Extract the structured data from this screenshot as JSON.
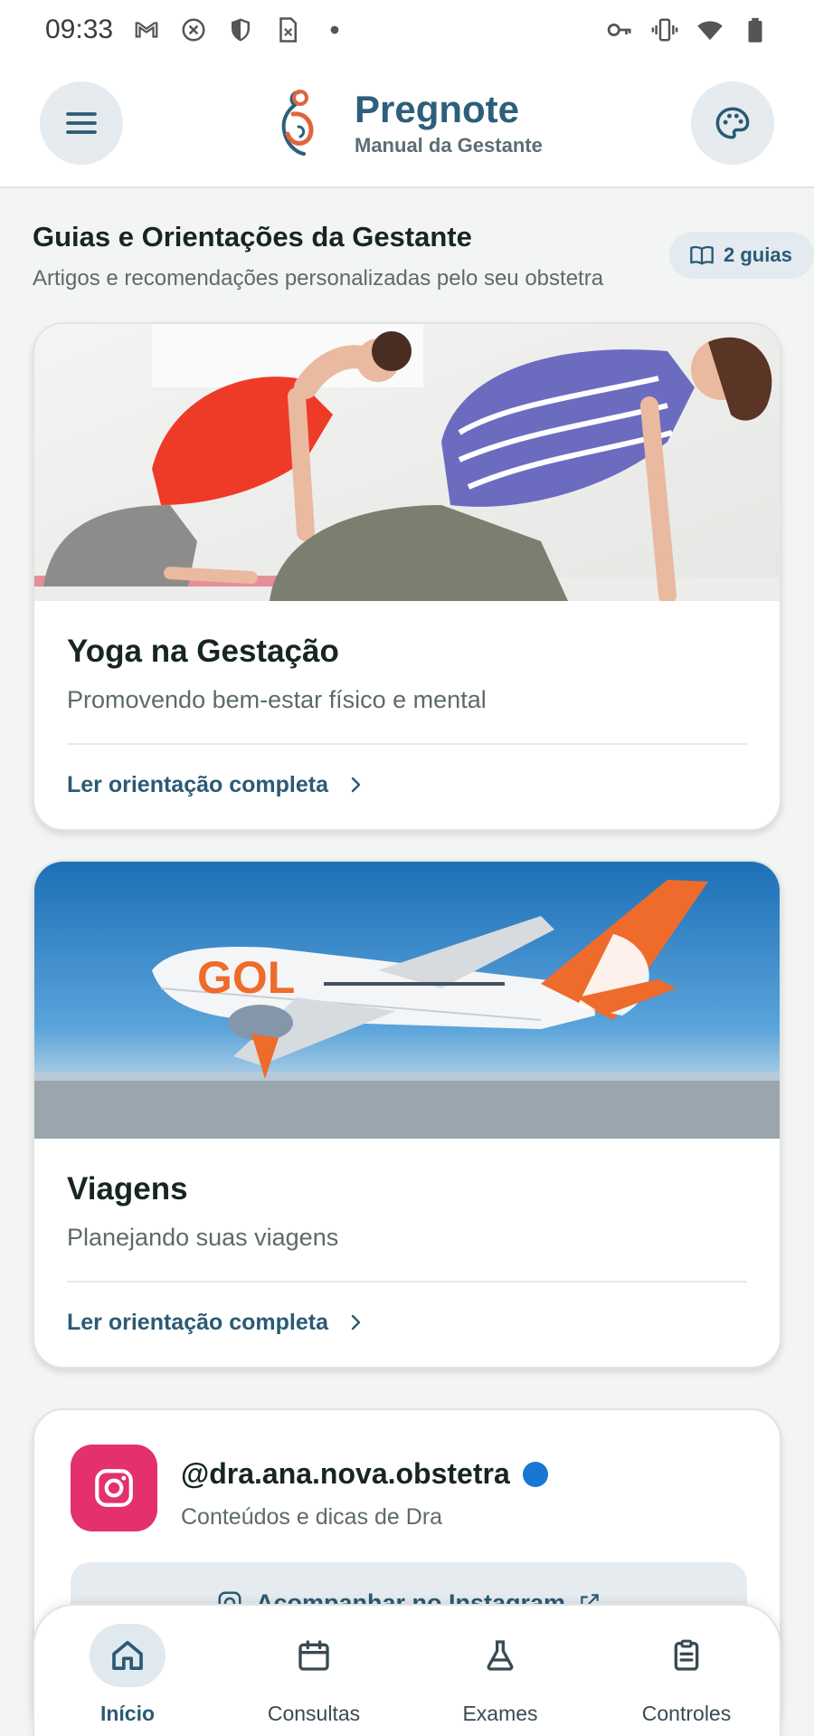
{
  "status_bar": {
    "time": "09:33",
    "left_icons": [
      "gmail-icon",
      "close-circle-icon",
      "shield-icon",
      "file-x-icon",
      "dot-icon"
    ],
    "right_icons": [
      "key-icon",
      "vibrate-icon",
      "wifi-icon",
      "battery-icon"
    ]
  },
  "app_bar": {
    "title": "Pregnote",
    "subtitle": "Manual da Gestante",
    "menu_icon": "hamburger-menu-icon",
    "palette_icon": "palette-icon"
  },
  "section": {
    "title": "Guias e Orientações da Gestante",
    "subtitle": "Artigos e recomendações personalizadas pelo seu obstetra",
    "badge": "2 guias"
  },
  "guides": [
    {
      "title": "Yoga na Gestação",
      "subtitle": "Promovendo bem-estar físico e mental",
      "link": "Ler orientação completa"
    },
    {
      "title": "Viagens",
      "subtitle": "Planejando suas viagens",
      "link": "Ler orientação completa"
    }
  ],
  "instagram": {
    "handle": "@dra.ana.nova.obstetra",
    "description": "Conteúdos e dicas de Dra",
    "button": "Acompanhar no Instagram"
  },
  "bottom_nav": [
    {
      "label": "Início",
      "icon": "home-icon",
      "active": true
    },
    {
      "label": "Consultas",
      "icon": "calendar-icon",
      "active": false
    },
    {
      "label": "Exames",
      "icon": "flask-icon",
      "active": false
    },
    {
      "label": "Controles",
      "icon": "clipboard-icon",
      "active": false
    }
  ],
  "colors": {
    "accent": "#2b5a74",
    "instagram": "#e4306c",
    "background": "#f3f5f4"
  }
}
